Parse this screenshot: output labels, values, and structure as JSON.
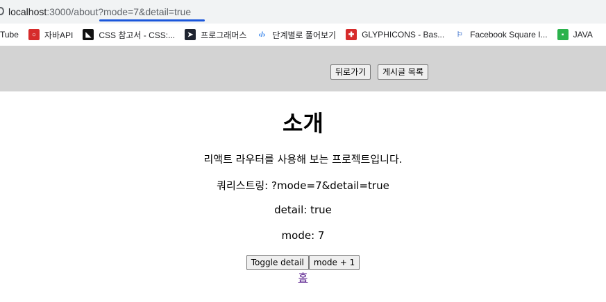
{
  "browser": {
    "url_host": "localhost",
    "url_rest": ":3000/about?mode=7&detail=true"
  },
  "bookmarks": [
    {
      "label": "Tube",
      "icon": "youtube-icon"
    },
    {
      "label": "자바API",
      "icon": "oracle-icon"
    },
    {
      "label": "CSS 참고서 - CSS:...",
      "icon": "mdn-icon"
    },
    {
      "label": "프로그래머스",
      "icon": "programmers-icon"
    },
    {
      "label": "단계별로 풀어보기",
      "icon": "code-icon"
    },
    {
      "label": "GLYPHICONS - Bas...",
      "icon": "glyphicons-icon"
    },
    {
      "label": "Facebook Square I...",
      "icon": "flag-icon"
    },
    {
      "label": "JAVA",
      "icon": "java-chat-icon"
    }
  ],
  "header": {
    "back_label": "뒤로가기",
    "list_label": "게시글 목록"
  },
  "main": {
    "title": "소개",
    "description": "리액트 라우터를 사용해 보는 프로젝트입니다.",
    "querystring": "쿼리스트링: ?mode=7&detail=true",
    "detail": "detail: true",
    "mode": "mode: 7",
    "toggle_label": "Toggle detail",
    "mode_plus_label": "mode + 1",
    "home_link": "홈"
  }
}
